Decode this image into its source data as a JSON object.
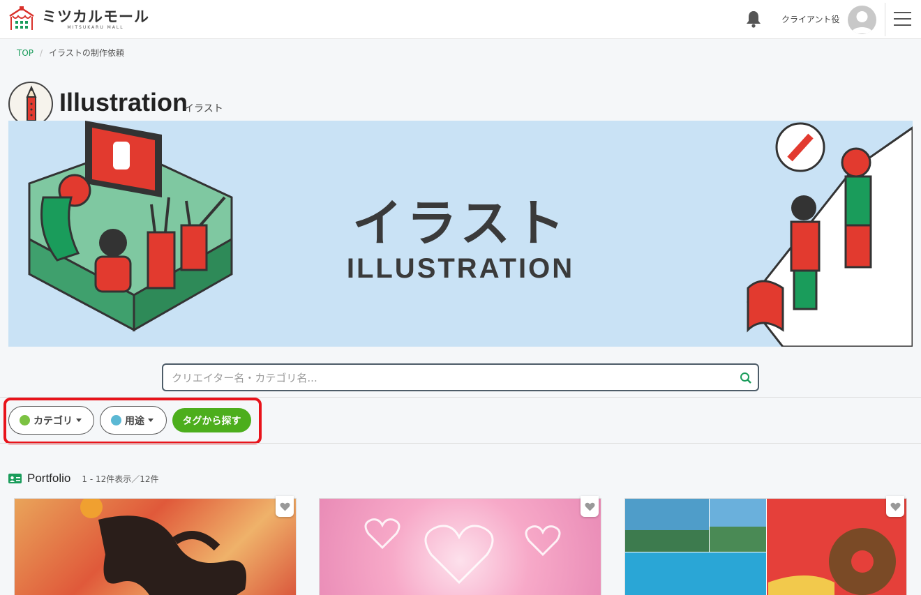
{
  "header": {
    "logo_name": "ミツカルモール",
    "logo_sub": "MITSUKARU MALL",
    "user_name": "クライアント役"
  },
  "breadcrumb": {
    "top": "TOP",
    "current": "イラストの制作依頼"
  },
  "category": {
    "title": "Illustration",
    "subtitle": "イラスト"
  },
  "banner": {
    "title_jp": "イラスト",
    "title_en": "ILLUSTRATION"
  },
  "search": {
    "placeholder": "クリエイター名・カテゴリ名..."
  },
  "filters": {
    "category_label": "カテゴリ",
    "category_dot_color": "#7cc242",
    "usage_label": "用途",
    "usage_dot_color": "#5bb8d4",
    "tag_button": "タグから探す"
  },
  "portfolio": {
    "title": "Portfolio",
    "count": "1 - 12件表示／12件"
  },
  "colors": {
    "accent_green": "#1a9c5b",
    "tag_green": "#4cae1c",
    "highlight_red": "#e8131b",
    "banner_bg": "#c9e2f5"
  }
}
